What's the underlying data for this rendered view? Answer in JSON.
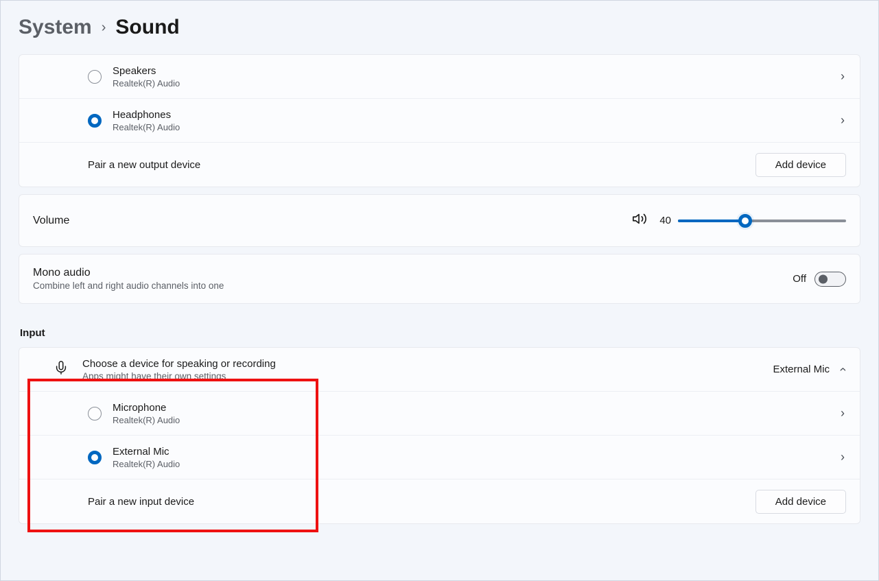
{
  "breadcrumb": {
    "parent": "System",
    "current": "Sound"
  },
  "output": {
    "devices": [
      {
        "name": "Speakers",
        "provider": "Realtek(R) Audio",
        "selected": false
      },
      {
        "name": "Headphones",
        "provider": "Realtek(R) Audio",
        "selected": true
      }
    ],
    "pair_label": "Pair a new output device",
    "add_button": "Add device"
  },
  "volume": {
    "label": "Volume",
    "value": 40
  },
  "mono": {
    "title": "Mono audio",
    "subtitle": "Combine left and right audio channels into one",
    "state_label": "Off"
  },
  "input": {
    "section_title": "Input",
    "header_title": "Choose a device for speaking or recording",
    "header_subtitle": "Apps might have their own settings",
    "summary_value": "External Mic",
    "devices": [
      {
        "name": "Microphone",
        "provider": "Realtek(R) Audio",
        "selected": false
      },
      {
        "name": "External Mic",
        "provider": "Realtek(R) Audio",
        "selected": true
      }
    ],
    "pair_label": "Pair a new input device",
    "add_button": "Add device"
  }
}
